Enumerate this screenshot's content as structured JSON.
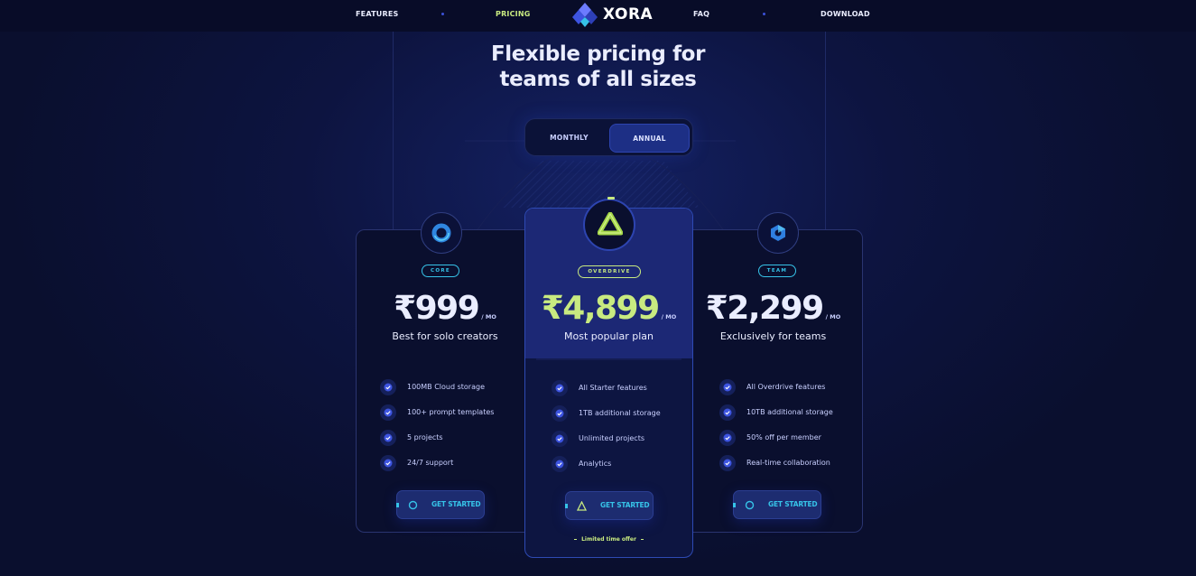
{
  "nav": {
    "features": "FEATURES",
    "pricing": "PRICING",
    "brand": "XORA",
    "faq": "FAQ",
    "download": "DOWNLOAD"
  },
  "hero": {
    "line1": "Flexible pricing for",
    "line2": "teams of all sizes"
  },
  "billing_toggle": {
    "monthly": "MONTHLY",
    "annual": "ANNUAL",
    "selected": "ANNUAL"
  },
  "plans": [
    {
      "badge": "CORE",
      "price": "₹999",
      "per": "/ MO",
      "tagline": "Best for solo creators",
      "features": [
        "100MB Cloud storage",
        "100+ prompt templates",
        "5 projects",
        "24/7 support"
      ],
      "cta": "GET STARTED",
      "icon": "ring-icon"
    },
    {
      "badge": "OVERDRIVE",
      "price": "₹4,899",
      "per": "/ MO",
      "tagline": "Most popular plan",
      "features": [
        "All Starter features",
        "1TB additional storage",
        "Unlimited projects",
        "Analytics"
      ],
      "cta": "GET STARTED",
      "offer": "Limited time offer",
      "icon": "triangle-icon"
    },
    {
      "badge": "TEAM",
      "price": "₹2,299",
      "per": "/ MO",
      "tagline": "Exclusively for teams",
      "features": [
        "All Overdrive features",
        "10TB additional storage",
        "50% off per member",
        "Real-time collaboration"
      ],
      "cta": "GET STARTED",
      "icon": "hexagon-icon"
    }
  ],
  "colors": {
    "background": "#0a0f2e",
    "accent_green": "#c8ea80",
    "accent_cyan": "#36c3e8",
    "accent_blue": "#2e4ab4"
  }
}
